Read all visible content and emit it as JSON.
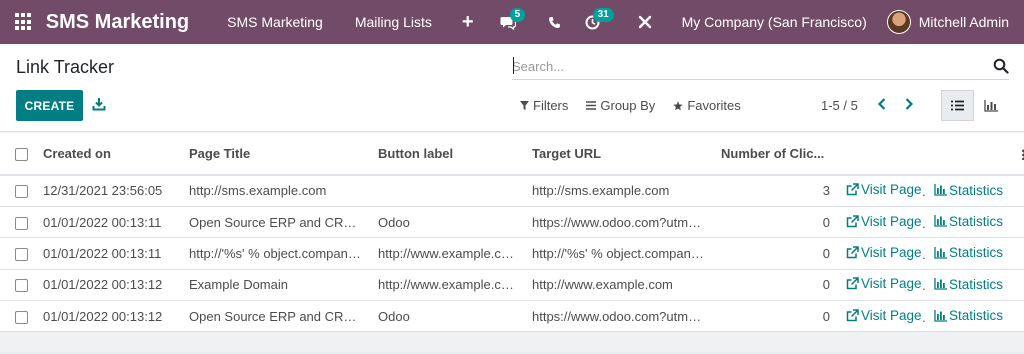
{
  "navbar": {
    "brand": "SMS Marketing",
    "menus": [
      "SMS Marketing",
      "Mailing Lists"
    ],
    "plus": "+",
    "chat_badge": "5",
    "activity_badge": "31",
    "company": "My Company (San Francisco)",
    "user": "Mitchell Admin",
    "colors": {
      "bar": "#714b67",
      "badge": "#00a09d"
    }
  },
  "control_panel": {
    "title": "Link Tracker",
    "search_placeholder": "Search...",
    "create_label": "CREATE",
    "filters_label": "Filters",
    "group_by_label": "Group By",
    "favorites_label": "Favorites",
    "pager": "1-5 / 5"
  },
  "table": {
    "columns": [
      "Created on",
      "Page Title",
      "Button label",
      "Target URL",
      "Number of Clic..."
    ],
    "visit_label": "Visit Page",
    "stats_label": "Statistics",
    "rows": [
      {
        "created": "12/31/2021 23:56:05",
        "title": "http://sms.example.com",
        "button": "",
        "url": "http://sms.example.com",
        "clicks": "3"
      },
      {
        "created": "01/01/2022 00:13:11",
        "title": "Open Source ERP and CRM | ...",
        "button": "Odoo",
        "url": "https://www.odoo.com?utm_...",
        "clicks": "0"
      },
      {
        "created": "01/01/2022 00:13:11",
        "title": "http://'%s' % object.company_...",
        "button": "http://www.example.co...",
        "url": "http://'%s' % object.company_...",
        "clicks": "0"
      },
      {
        "created": "01/01/2022 00:13:12",
        "title": "Example Domain",
        "button": "http://www.example.co...",
        "url": "http://www.example.com",
        "clicks": "0"
      },
      {
        "created": "01/01/2022 00:13:12",
        "title": "Open Source ERP and CRM | ...",
        "button": "Odoo",
        "url": "https://www.odoo.com?utm_...",
        "clicks": "0"
      }
    ]
  }
}
